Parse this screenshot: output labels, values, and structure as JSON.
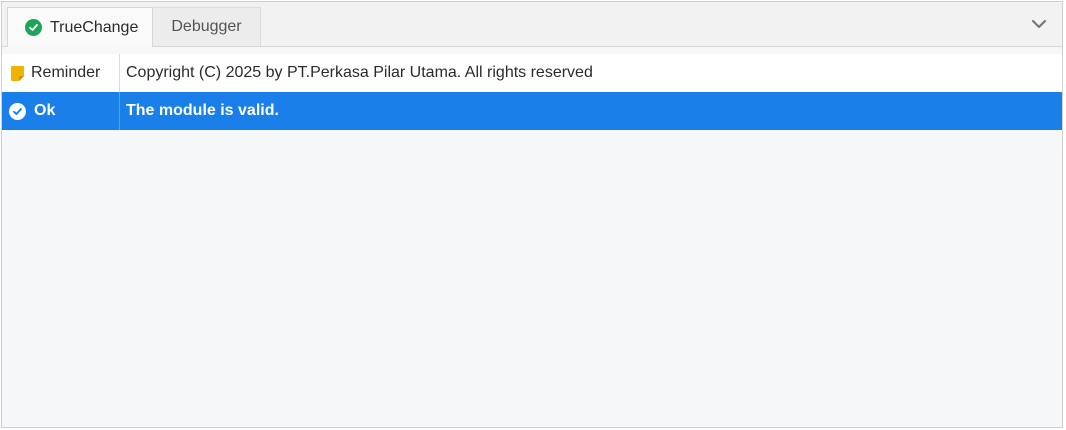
{
  "tabs": [
    {
      "label": "TrueChange",
      "icon": "check-circle-icon",
      "active": true
    },
    {
      "label": "Debugger",
      "active": false
    }
  ],
  "collapse_icon": "chevron-down-icon",
  "messages": [
    {
      "type": "Reminder",
      "icon": "note-icon",
      "text": "Copyright (C) 2025 by PT.Perkasa Pilar Utama. All rights reserved"
    },
    {
      "type": "Ok",
      "icon": "ok-check-icon",
      "text": "The module is valid."
    }
  ],
  "colors": {
    "accent": "#1a7fe8",
    "success": "#1fa55b",
    "reminder": "#f0b400"
  }
}
